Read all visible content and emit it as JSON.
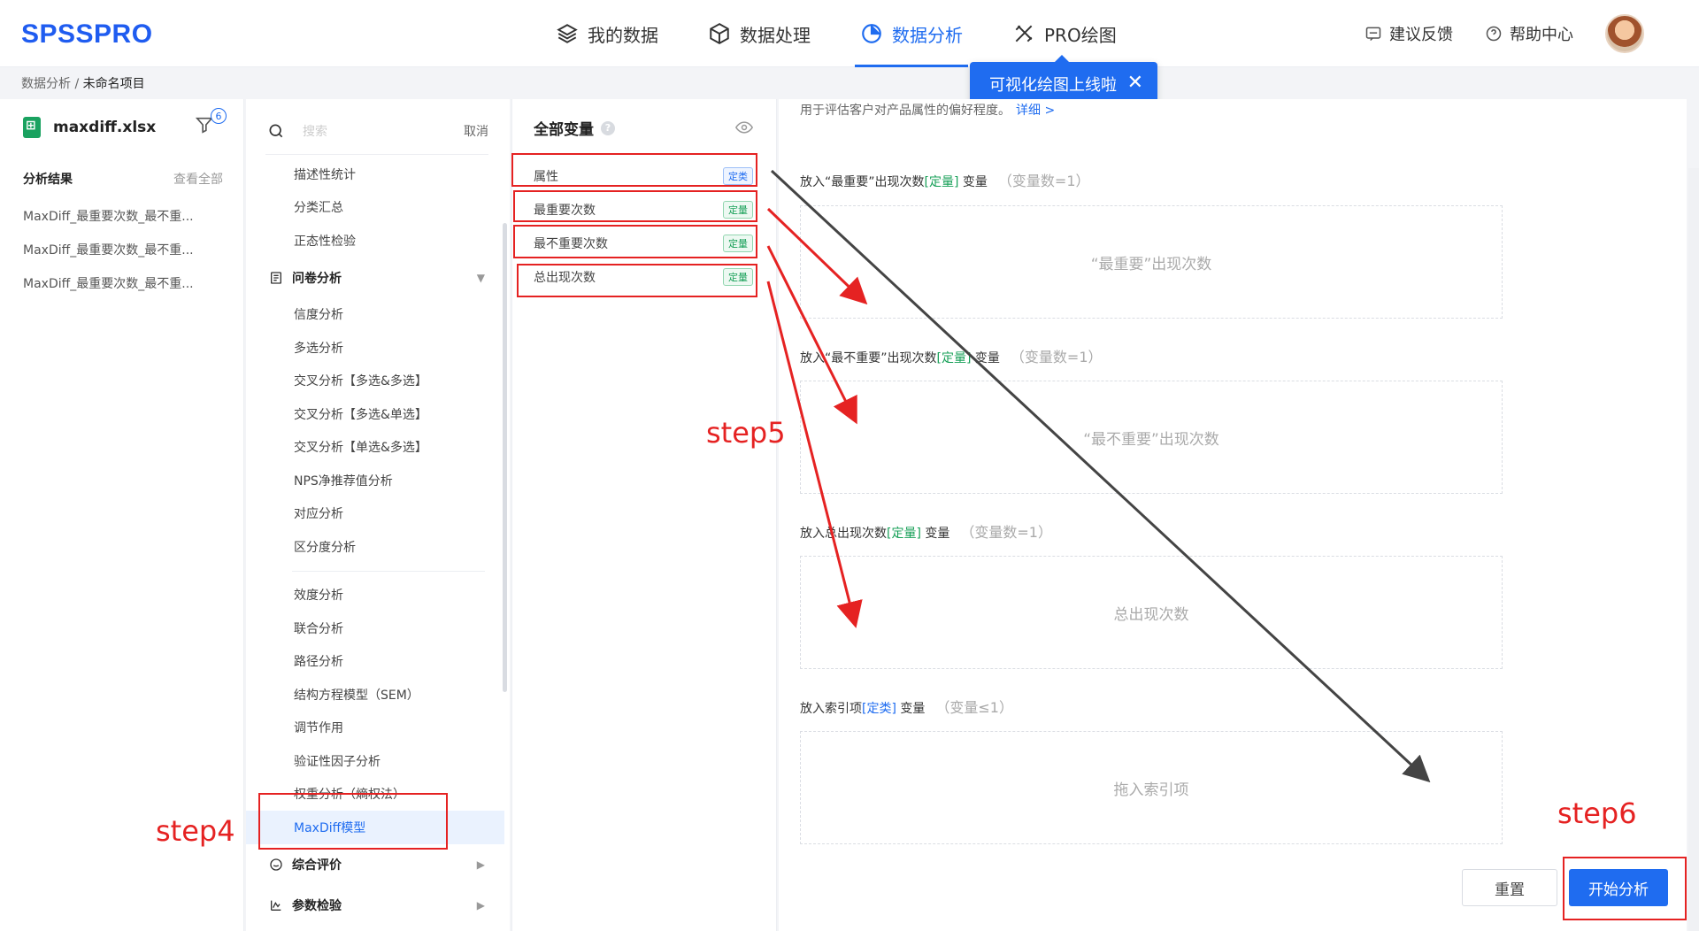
{
  "header": {
    "logo": "SPSSPRO",
    "nav": [
      {
        "label": "我的数据",
        "icon": "layers-icon"
      },
      {
        "label": "数据处理",
        "icon": "cube-icon"
      },
      {
        "label": "数据分析",
        "icon": "pie-chart-icon",
        "active": true
      },
      {
        "label": "PRO绘图",
        "icon": "drawing-tools-icon"
      }
    ],
    "feedback": "建议反馈",
    "help": "帮助中心"
  },
  "popup": {
    "text": "可视化绘图上线啦",
    "close": "✕"
  },
  "breadcrumb": {
    "parent": "数据分析",
    "sep": " / ",
    "current": "未命名项目"
  },
  "sidebar": {
    "file_name": "maxdiff.xlsx",
    "filter_count": "6",
    "results_title": "分析结果",
    "view_all": "查看全部",
    "results": [
      "MaxDiff_最重要次数_最不重...",
      "MaxDiff_最重要次数_最不重...",
      "MaxDiff_最重要次数_最不重..."
    ]
  },
  "methods": {
    "search_placeholder": "搜索",
    "cancel": "取消",
    "top_items": [
      "描述性统计",
      "分类汇总",
      "正态性检验"
    ],
    "group_survey": "问卷分析",
    "survey_items": [
      "信度分析",
      "多选分析",
      "交叉分析【多选&多选】",
      "交叉分析【多选&单选】",
      "交叉分析【单选&多选】",
      "NPS净推荐值分析",
      "对应分析",
      "区分度分析"
    ],
    "survey_items2": [
      "效度分析",
      "联合分析",
      "路径分析",
      "结构方程模型（SEM）",
      "调节作用",
      "验证性因子分析",
      "权重分析（熵权法）",
      "MaxDiff模型"
    ],
    "group_eval": "综合评价",
    "group_param": "参数检验"
  },
  "variables": {
    "title": "全部变量",
    "help": "?",
    "items": [
      {
        "name": "属性",
        "tag": "定类",
        "kind": "cat"
      },
      {
        "name": "最重要次数",
        "tag": "定量",
        "kind": "qty"
      },
      {
        "name": "最不重要次数",
        "tag": "定量",
        "kind": "qty"
      },
      {
        "name": "总出现次数",
        "tag": "定量",
        "kind": "qty"
      }
    ]
  },
  "config": {
    "description": "用于评估客户对产品属性的偏好程度。",
    "detail_link": "详细 >",
    "zones": [
      {
        "prefix": "放入“最重要”出现次数",
        "tag": "[定量]",
        "kind": "qty",
        "suffix": " 变量",
        "count": "（变量数=1）",
        "placeholder": "“最重要”出现次数"
      },
      {
        "prefix": "放入“最不重要”出现次数",
        "tag": "[定量]",
        "kind": "qty",
        "suffix": " 变量",
        "count": "（变量数=1）",
        "placeholder": "“最不重要”出现次数"
      },
      {
        "prefix": "放入总出现次数",
        "tag": "[定量]",
        "kind": "qty",
        "suffix": " 变量",
        "count": "（变量数=1）",
        "placeholder": "总出现次数"
      },
      {
        "prefix": "放入索引项",
        "tag": "[定类]",
        "kind": "cat",
        "suffix": " 变量",
        "count": "（变量≤1）",
        "placeholder": "拖入索引项"
      }
    ],
    "reset": "重置",
    "start": "开始分析"
  },
  "annotations": {
    "step4": "step4",
    "step5": "step5",
    "step6": "step6",
    "color": "#e52222"
  }
}
